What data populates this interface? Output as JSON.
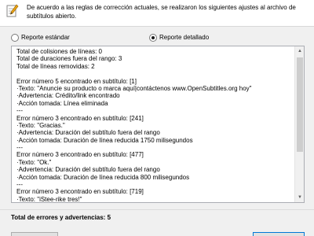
{
  "header": {
    "message": "De acuerdo a las reglas de corrección actuales, se realizaron los siguientes ajustes al archivo de subtítulos abierto.",
    "icon": "edit-document-icon"
  },
  "report_options": {
    "standard_label": "Reporte estándar",
    "detailed_label": "Reporte detallado",
    "selected": "detailed"
  },
  "log": {
    "lines": [
      "Total de colisiones de líneas: 0",
      "Total de duraciones fuera del rango: 3",
      "Total de líneas removidas: 2",
      "",
      "Error número 5 encontrado en subtítulo: [1]",
      "·Texto: \"Anuncie su producto o marca aquí|contáctenos www.OpenSubtitles.org hoy\"",
      "·Advertencia: Crédito/link encontrado",
      "·Acción tomada: Línea eliminada",
      "---",
      "Error número 3 encontrado en subtítulo: [241]",
      "·Texto: \"Gracias.\"",
      "·Advertencia: Duración del subtítulo fuera del rango",
      "·Acción tomada: Duración de línea reducida 1750 milisegundos",
      "---",
      "Error número 3 encontrado en subtítulo: [477]",
      "·Texto: \"Ok.\"",
      "·Advertencia: Duración del subtítulo fuera del rango",
      "·Acción tomada: Duración de línea reducida 800 milisegundos",
      "---",
      "Error número 3 encontrado en subtítulo: [719]",
      "·Texto: \"iStee-rike tres!\""
    ]
  },
  "summary": {
    "total_label": "Total de errores y advertencias: 5"
  }
}
